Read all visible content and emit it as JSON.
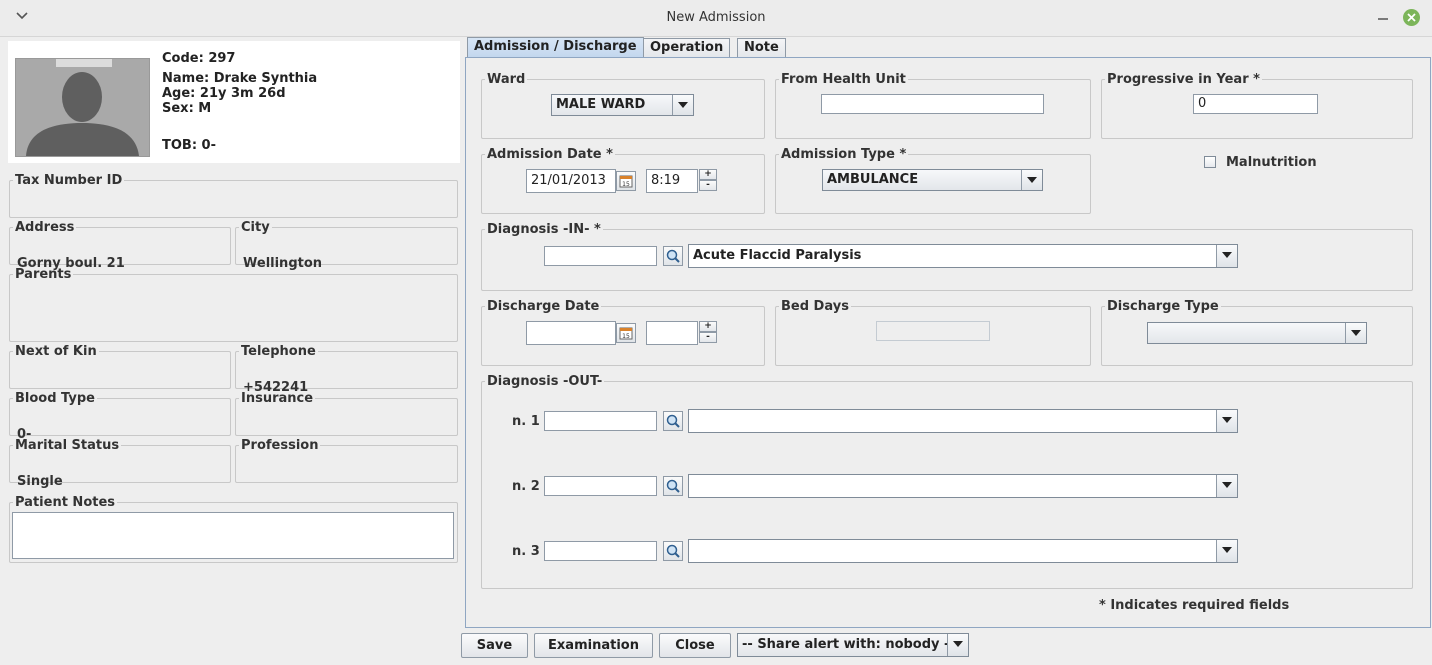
{
  "window": {
    "title": "New Admission"
  },
  "patient": {
    "code": "Code: 297",
    "name": "Name: Drake Synthia",
    "age": "Age: 21y 3m 26d",
    "sex": "Sex: M",
    "tob": "TOB: 0-"
  },
  "left": {
    "tax": {
      "label": "Tax Number ID",
      "value": ""
    },
    "address": {
      "label": "Address",
      "value": "Gorny boul. 21"
    },
    "city": {
      "label": "City",
      "value": "Wellington"
    },
    "parents": {
      "label": "Parents",
      "value": ""
    },
    "kin": {
      "label": "Next of Kin",
      "value": ""
    },
    "telephone": {
      "label": "Telephone",
      "value": "+542241"
    },
    "blood": {
      "label": "Blood Type",
      "value": "0-"
    },
    "insurance": {
      "label": "Insurance",
      "value": ""
    },
    "marital": {
      "label": "Marital Status",
      "value": "Single"
    },
    "profession": {
      "label": "Profession",
      "value": ""
    },
    "notes": {
      "label": "Patient Notes",
      "value": ""
    }
  },
  "tabs": [
    {
      "label": "Admission / Discharge",
      "active": true
    },
    {
      "label": "Operation",
      "active": false
    },
    {
      "label": "Note",
      "active": false
    }
  ],
  "form": {
    "ward": {
      "label": "Ward",
      "value": "MALE WARD"
    },
    "from_health_unit": {
      "label": "From Health Unit",
      "value": ""
    },
    "progressive": {
      "label": "Progressive in Year *",
      "value": "0"
    },
    "admission_date": {
      "label": "Admission Date *",
      "date": "21/01/2013",
      "time": "8:19"
    },
    "admission_type": {
      "label": "Admission Type *",
      "value": "AMBULANCE"
    },
    "malnutrition": {
      "label": "Malnutrition",
      "checked": false
    },
    "diagnosis_in": {
      "label": "Diagnosis -IN- *",
      "code": "",
      "value": "Acute Flaccid Paralysis"
    },
    "discharge_date": {
      "label": "Discharge Date",
      "date": "",
      "time": ""
    },
    "bed_days": {
      "label": "Bed Days",
      "value": ""
    },
    "discharge_type": {
      "label": "Discharge Type",
      "value": ""
    },
    "diagnosis_out": {
      "label": "Diagnosis -OUT-",
      "rows": [
        {
          "label": "n. 1",
          "code": "",
          "value": ""
        },
        {
          "label": "n. 2",
          "code": "",
          "value": ""
        },
        {
          "label": "n. 3",
          "code": "",
          "value": ""
        }
      ]
    },
    "required_note": "* Indicates required fields"
  },
  "buttons": {
    "save": "Save",
    "examination": "Examination",
    "close": "Close",
    "share": "-- Share alert with: nobody --"
  },
  "spinner": {
    "up": "+",
    "down": "-"
  }
}
